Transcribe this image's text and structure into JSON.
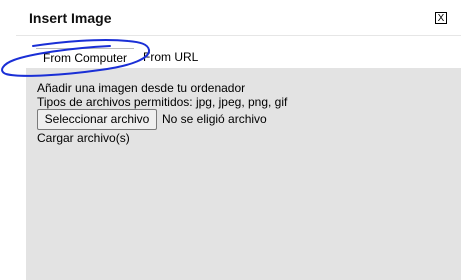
{
  "dialog": {
    "title": "Insert Image",
    "close_label": "X"
  },
  "tabs": [
    {
      "label": "From Computer"
    },
    {
      "label": "From URL"
    }
  ],
  "panel": {
    "line1": "Añadir una imagen desde tu ordenador",
    "line2": "Tipos de archivos permitidos: jpg, jpeg, png, gif",
    "file_button_label": "Seleccionar archivo",
    "file_status": "No se eligió archivo",
    "upload_label": "Cargar archivo(s)"
  },
  "colors": {
    "panel_background": "#e3e3e3",
    "annotation_stroke": "#1a2fd6"
  }
}
